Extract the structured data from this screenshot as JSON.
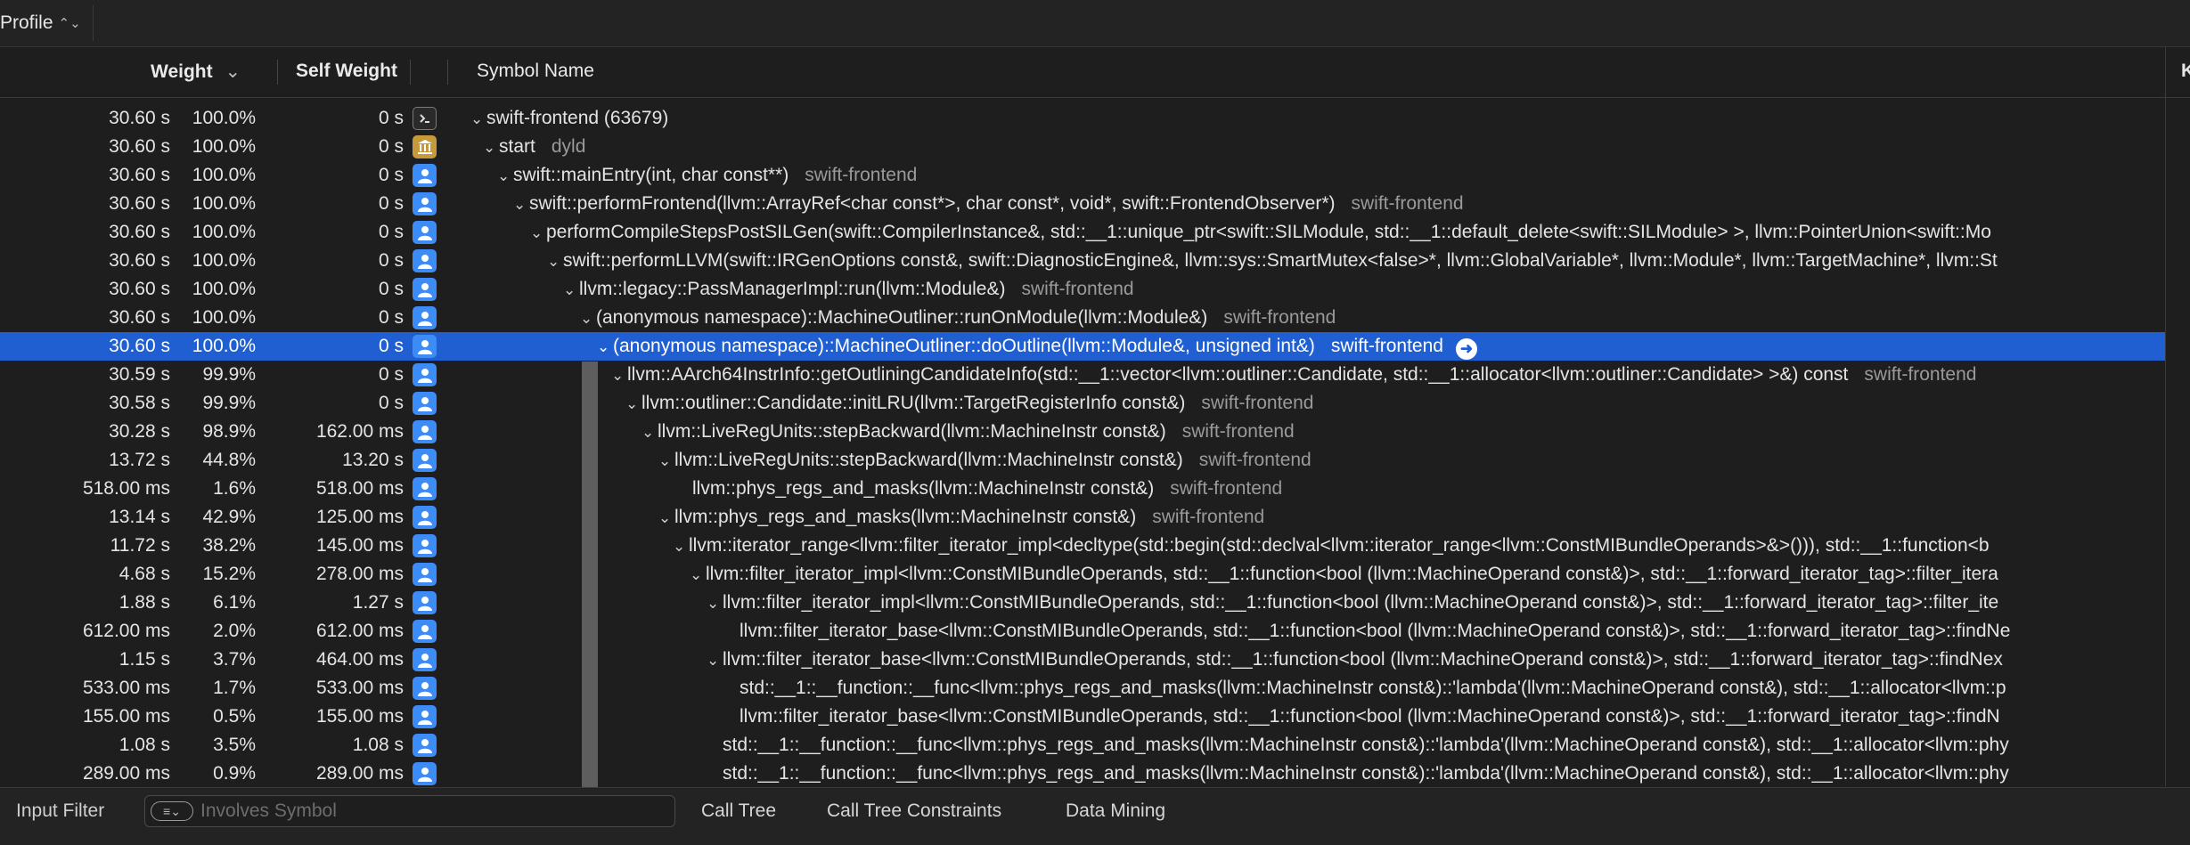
{
  "toolbar": {
    "profile_label": "Profile",
    "profile_chevron": "⌃⌄"
  },
  "columns": {
    "weight": "Weight",
    "weight_sort": "⌄",
    "self_weight": "Self Weight",
    "symbol_name": "Symbol Name",
    "edge_label": "K"
  },
  "icons": {
    "user": "person-icon",
    "library": "building-columns-icon",
    "terminal": "terminal-icon"
  },
  "colors": {
    "selection": "#1f5fd1",
    "user_icon": "#3d8bf5",
    "library_icon": "#c69a3c"
  },
  "rows": [
    {
      "weight": "30.60 s",
      "pct": "100.0%",
      "self": "0 s",
      "icon": "terminal",
      "sym": "swift-frontend (63679)",
      "lib": "",
      "disc": "⌄"
    },
    {
      "weight": "30.60 s",
      "pct": "100.0%",
      "self": "0 s",
      "icon": "library",
      "sym": "start",
      "lib": "dyld",
      "disc": "⌄"
    },
    {
      "weight": "30.60 s",
      "pct": "100.0%",
      "self": "0 s",
      "icon": "user",
      "sym": "swift::mainEntry(int, char const**)",
      "lib": "swift-frontend",
      "disc": "⌄"
    },
    {
      "weight": "30.60 s",
      "pct": "100.0%",
      "self": "0 s",
      "icon": "user",
      "sym": "swift::performFrontend(llvm::ArrayRef<char const*>, char const*, void*, swift::FrontendObserver*)",
      "lib": "swift-frontend",
      "disc": "⌄"
    },
    {
      "weight": "30.60 s",
      "pct": "100.0%",
      "self": "0 s",
      "icon": "user",
      "sym": "performCompileStepsPostSILGen(swift::CompilerInstance&, std::__1::unique_ptr<swift::SILModule, std::__1::default_delete<swift::SILModule> >, llvm::PointerUnion<swift::Mo",
      "lib": "",
      "disc": "⌄"
    },
    {
      "weight": "30.60 s",
      "pct": "100.0%",
      "self": "0 s",
      "icon": "user",
      "sym": "swift::performLLVM(swift::IRGenOptions const&, swift::DiagnosticEngine&, llvm::sys::SmartMutex<false>*, llvm::GlobalVariable*, llvm::Module*, llvm::TargetMachine*, llvm::St",
      "lib": "",
      "disc": "⌄"
    },
    {
      "weight": "30.60 s",
      "pct": "100.0%",
      "self": "0 s",
      "icon": "user",
      "sym": "llvm::legacy::PassManagerImpl::run(llvm::Module&)",
      "lib": "swift-frontend",
      "disc": "⌄"
    },
    {
      "weight": "30.60 s",
      "pct": "100.0%",
      "self": "0 s",
      "icon": "user",
      "sym": "(anonymous namespace)::MachineOutliner::runOnModule(llvm::Module&)",
      "lib": "swift-frontend",
      "disc": "⌄"
    },
    {
      "weight": "30.60 s",
      "pct": "100.0%",
      "self": "0 s",
      "icon": "user",
      "sym": "(anonymous namespace)::MachineOutliner::doOutline(llvm::Module&, unsigned int&)",
      "lib": "swift-frontend",
      "disc": "⌄",
      "selected": true
    },
    {
      "weight": "30.59 s",
      "pct": "99.9%",
      "self": "0 s",
      "icon": "user",
      "sym": "llvm::AArch64InstrInfo::getOutliningCandidateInfo(std::__1::vector<llvm::outliner::Candidate, std::__1::allocator<llvm::outliner::Candidate> >&) const",
      "lib": "swift-frontend",
      "disc": "⌄"
    },
    {
      "weight": "30.58 s",
      "pct": "99.9%",
      "self": "0 s",
      "icon": "user",
      "sym": "llvm::outliner::Candidate::initLRU(llvm::TargetRegisterInfo const&)",
      "lib": "swift-frontend",
      "disc": "⌄"
    },
    {
      "weight": "30.28 s",
      "pct": "98.9%",
      "self": "162.00 ms",
      "icon": "user",
      "sym": "llvm::LiveRegUnits::stepBackward(llvm::MachineInstr const&)",
      "lib": "swift-frontend",
      "disc": "⌄"
    },
    {
      "weight": "13.72 s",
      "pct": "44.8%",
      "self": "13.20 s",
      "icon": "user",
      "sym": "llvm::LiveRegUnits::stepBackward(llvm::MachineInstr const&)",
      "lib": "swift-frontend",
      "disc": "⌄"
    },
    {
      "weight": "518.00 ms",
      "pct": "1.6%",
      "self": "518.00 ms",
      "icon": "user",
      "sym": "llvm::phys_regs_and_masks(llvm::MachineInstr const&)",
      "lib": "swift-frontend",
      "disc": ""
    },
    {
      "weight": "13.14 s",
      "pct": "42.9%",
      "self": "125.00 ms",
      "icon": "user",
      "sym": "llvm::phys_regs_and_masks(llvm::MachineInstr const&)",
      "lib": "swift-frontend",
      "disc": "⌄"
    },
    {
      "weight": "11.72 s",
      "pct": "38.2%",
      "self": "145.00 ms",
      "icon": "user",
      "sym": "llvm::iterator_range<llvm::filter_iterator_impl<decltype(std::begin(std::declval<llvm::iterator_range<llvm::ConstMIBundleOperands>&>())), std::__1::function<b",
      "lib": "",
      "disc": "⌄"
    },
    {
      "weight": "4.68 s",
      "pct": "15.2%",
      "self": "278.00 ms",
      "icon": "user",
      "sym": "llvm::filter_iterator_impl<llvm::ConstMIBundleOperands, std::__1::function<bool (llvm::MachineOperand const&)>, std::__1::forward_iterator_tag>::filter_itera",
      "lib": "",
      "disc": "⌄"
    },
    {
      "weight": "1.88 s",
      "pct": "6.1%",
      "self": "1.27 s",
      "icon": "user",
      "sym": "llvm::filter_iterator_impl<llvm::ConstMIBundleOperands, std::__1::function<bool (llvm::MachineOperand const&)>, std::__1::forward_iterator_tag>::filter_ite",
      "lib": "",
      "disc": "⌄"
    },
    {
      "weight": "612.00 ms",
      "pct": "2.0%",
      "self": "612.00 ms",
      "icon": "user",
      "sym": "llvm::filter_iterator_base<llvm::ConstMIBundleOperands, std::__1::function<bool (llvm::MachineOperand const&)>, std::__1::forward_iterator_tag>::findNe",
      "lib": "",
      "disc": ""
    },
    {
      "weight": "1.15 s",
      "pct": "3.7%",
      "self": "464.00 ms",
      "icon": "user",
      "sym": "llvm::filter_iterator_base<llvm::ConstMIBundleOperands, std::__1::function<bool (llvm::MachineOperand const&)>, std::__1::forward_iterator_tag>::findNex",
      "lib": "",
      "disc": "⌄"
    },
    {
      "weight": "533.00 ms",
      "pct": "1.7%",
      "self": "533.00 ms",
      "icon": "user",
      "sym": "std::__1::__function::__func<llvm::phys_regs_and_masks(llvm::MachineInstr const&)::'lambda'(llvm::MachineOperand const&), std::__1::allocator<llvm::p",
      "lib": "",
      "disc": ""
    },
    {
      "weight": "155.00 ms",
      "pct": "0.5%",
      "self": "155.00 ms",
      "icon": "user",
      "sym": "llvm::filter_iterator_base<llvm::ConstMIBundleOperands, std::__1::function<bool (llvm::MachineOperand const&)>, std::__1::forward_iterator_tag>::findN",
      "lib": "",
      "disc": ""
    },
    {
      "weight": "1.08 s",
      "pct": "3.5%",
      "self": "1.08 s",
      "icon": "user",
      "sym": "std::__1::__function::__func<llvm::phys_regs_and_masks(llvm::MachineInstr const&)::'lambda'(llvm::MachineOperand const&), std::__1::allocator<llvm::phy",
      "lib": "",
      "disc": ""
    },
    {
      "weight": "289.00 ms",
      "pct": "0.9%",
      "self": "289.00 ms",
      "icon": "user",
      "sym": "std::__1::__function::__func<llvm::phys_regs_and_masks(llvm::MachineInstr const&)::'lambda'(llvm::MachineOperand const&), std::__1::allocator<llvm::phy",
      "lib": "",
      "disc": ""
    }
  ],
  "bottom": {
    "input_filter": "Input Filter",
    "filter_placeholder": "Involves Symbol",
    "filter_pill": "≡⌄",
    "tab_call_tree": "Call Tree",
    "tab_constraints": "Call Tree Constraints",
    "tab_data_mining": "Data Mining"
  },
  "goto_arrow": "➜"
}
